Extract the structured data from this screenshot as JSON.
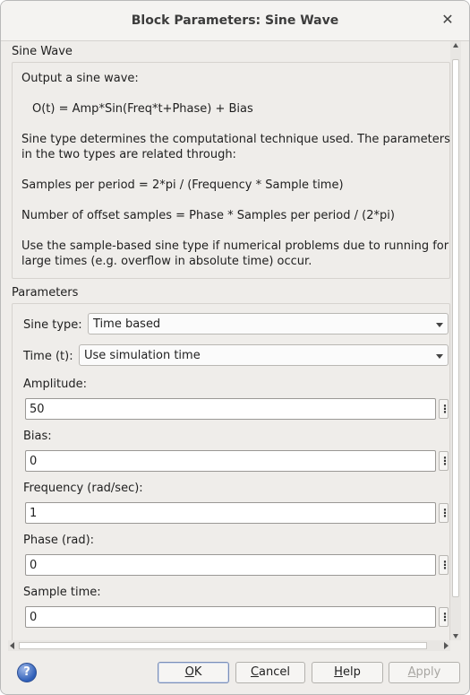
{
  "window": {
    "title": "Block Parameters: Sine Wave",
    "close_glyph": "✕"
  },
  "description": {
    "section_title": "Sine Wave",
    "lines": [
      "Output a sine wave:",
      "O(t) = Amp*Sin(Freq*t+Phase) + Bias",
      "Sine type determines the computational technique used. The parameters",
      "in the two types are related through:",
      "Samples per period = 2*pi / (Frequency * Sample time)",
      "Number of offset samples = Phase * Samples per period / (2*pi)",
      "Use the sample-based sine type if numerical problems due to running for",
      "large times (e.g. overflow in absolute time) occur."
    ]
  },
  "parameters": {
    "section_title": "Parameters",
    "sine_type": {
      "label": "Sine type:",
      "value": "Time based"
    },
    "time": {
      "label": "Time (t):",
      "value": "Use simulation time"
    },
    "amplitude": {
      "label": "Amplitude:",
      "value": "50"
    },
    "bias": {
      "label": "Bias:",
      "value": "0"
    },
    "frequency": {
      "label": "Frequency (rad/sec):",
      "value": "1"
    },
    "phase": {
      "label": "Phase (rad):",
      "value": "0"
    },
    "sample_time": {
      "label": "Sample time:",
      "value": "0"
    },
    "kebab_glyph": "⋮"
  },
  "buttons": {
    "help_glyph": "?",
    "ok": {
      "mnemonic": "O",
      "rest": "K"
    },
    "cancel": {
      "mnemonic": "C",
      "rest": "ancel"
    },
    "help": {
      "mnemonic": "H",
      "rest": "elp"
    },
    "apply": {
      "mnemonic": "A",
      "rest": "pply"
    }
  },
  "colors": {
    "background": "#efedea",
    "accent": "#2f5fb8"
  }
}
